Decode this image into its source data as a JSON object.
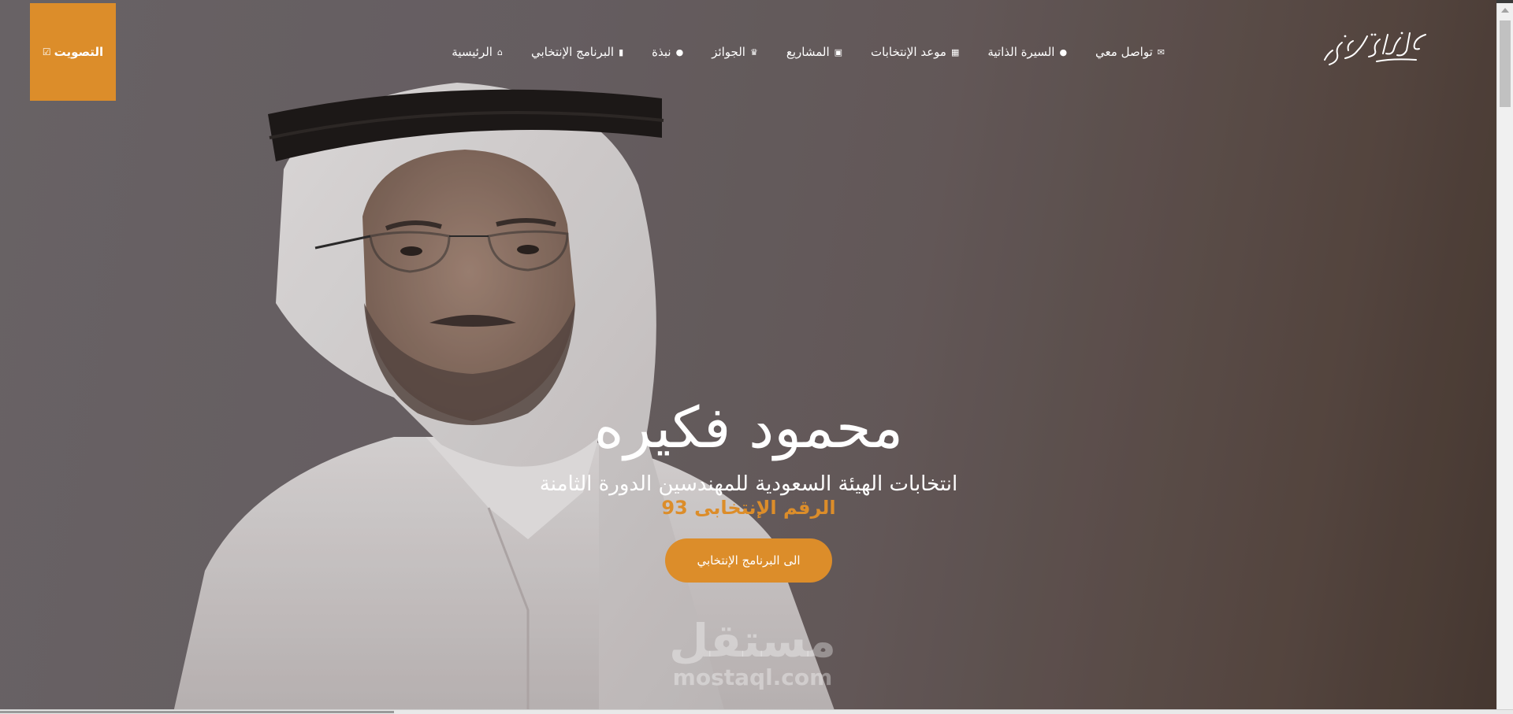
{
  "nav": {
    "vote_label": "التصويت",
    "items": [
      {
        "label": "الرئيسية",
        "icon": "home-icon"
      },
      {
        "label": "البرنامج الإنتخابي",
        "icon": "book-icon"
      },
      {
        "label": "نبذة",
        "icon": "user-icon"
      },
      {
        "label": "الجوائز",
        "icon": "trophy-icon"
      },
      {
        "label": "المشاريع",
        "icon": "image-icon"
      },
      {
        "label": "موعد الإنتخابات",
        "icon": "calendar-icon"
      },
      {
        "label": "السيرة الذاتية",
        "icon": "user-icon"
      },
      {
        "label": "تواصل معي",
        "icon": "envelope-icon"
      }
    ],
    "logo_text": "محمود بن محمد سليم فكيره"
  },
  "hero": {
    "name": "محمود فكيره",
    "subtitle": "انتخابات الهيئة السعودية للمهندسين الدورة الثامنة",
    "number_label": "الرقم الإنتخابى 93",
    "cta_label": "الى البرنامج الإنتخابي"
  },
  "watermark": {
    "arabic": "مستقل",
    "latin": "mostaql.com"
  },
  "colors": {
    "accent": "#dc8d2a",
    "nav_text": "#ffffff"
  }
}
